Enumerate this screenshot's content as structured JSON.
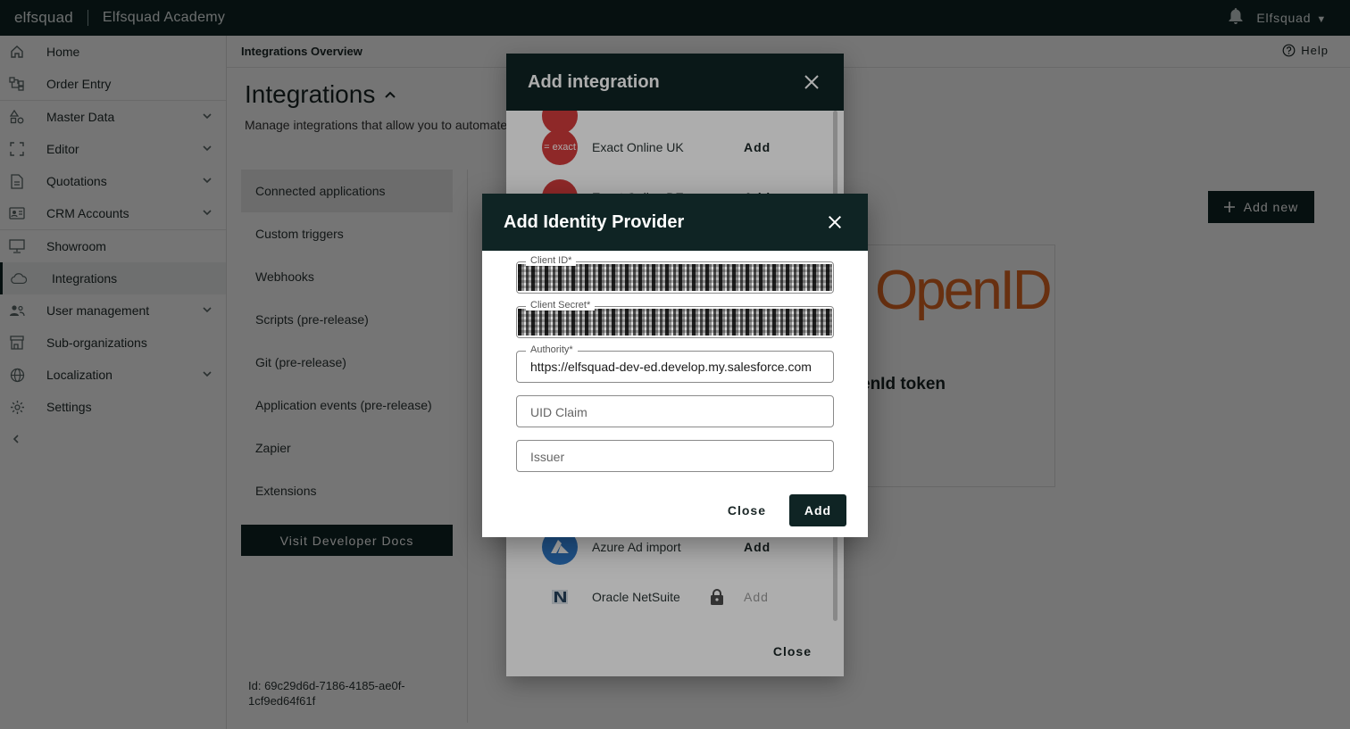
{
  "topbar": {
    "logo": "elfsquad",
    "app_name": "Elfsquad Academy",
    "user": "Elfsquad"
  },
  "sidebar": {
    "items": [
      {
        "label": "Home",
        "icon": "home-icon"
      },
      {
        "label": "Order Entry",
        "icon": "order-entry-icon"
      },
      {
        "label": "Master Data",
        "icon": "shapes-icon"
      },
      {
        "label": "Editor",
        "icon": "editor-icon"
      },
      {
        "label": "Quotations",
        "icon": "document-icon"
      },
      {
        "label": "CRM Accounts",
        "icon": "contact-card-icon"
      },
      {
        "label": "Showroom",
        "icon": "monitor-icon"
      },
      {
        "label": "Integrations",
        "icon": "cloud-icon"
      },
      {
        "label": "User management",
        "icon": "users-icon"
      },
      {
        "label": "Sub-organizations",
        "icon": "store-icon"
      },
      {
        "label": "Localization",
        "icon": "globe-icon"
      },
      {
        "label": "Settings",
        "icon": "gear-icon"
      }
    ]
  },
  "main": {
    "breadcrumb": "Integrations Overview",
    "help": "Help",
    "title": "Integrations",
    "description": "Manage integrations that allow you to automate",
    "sub_nav": [
      "Connected applications",
      "Custom triggers",
      "Webhooks",
      "Scripts (pre-release)",
      "Git (pre-release)",
      "Application events (pre-release)",
      "Zapier",
      "Extensions"
    ],
    "docs_button": "Visit Developer Docs",
    "id_text": "Id: 69c29d6d-7186-4185-ae0f-1cf9ed64f61f",
    "add_new": "Add new",
    "card_logo": "OpenID",
    "card_title": "enId token"
  },
  "add_integration": {
    "title": "Add integration",
    "items": [
      {
        "name": "Exact Online UK",
        "action": "Add",
        "logo_text": "= exact",
        "color": "#d13b3b"
      },
      {
        "name": "Exact Online DE",
        "action": "Add",
        "logo_text": "",
        "color": "#d13b3b"
      },
      {
        "name": "Azure Ad import",
        "action": "Add",
        "logo_text": "",
        "color": "#2e78c7"
      },
      {
        "name": "Oracle NetSuite",
        "action": "Add",
        "logo_text": "N",
        "color": "#27435e"
      }
    ],
    "close": "Close"
  },
  "identity_provider": {
    "title": "Add Identity Provider",
    "fields": {
      "client_id": {
        "label": "Client ID*"
      },
      "client_secret": {
        "label": "Client Secret*"
      },
      "authority": {
        "label": "Authority*",
        "value": "https://elfsquad-dev-ed.develop.my.salesforce.com"
      },
      "uid_claim": {
        "placeholder": "UID Claim"
      },
      "issuer": {
        "placeholder": "Issuer"
      }
    },
    "close": "Close",
    "add": "Add"
  },
  "colors": {
    "primary": "#0f2424",
    "openid_orange": "#e36a25"
  }
}
